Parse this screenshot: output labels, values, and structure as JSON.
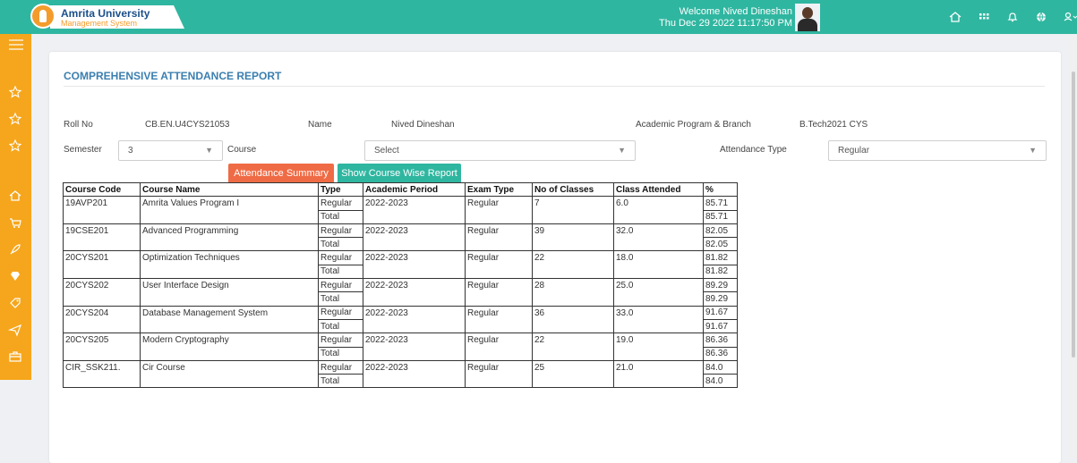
{
  "app": {
    "title": "Amrita University",
    "subtitle": "Management System"
  },
  "header": {
    "welcome": "Welcome Nived Dineshan",
    "datetime": "Thu Dec 29 2022 11:17:50 PM",
    "icons": [
      "home-icon",
      "apps-grid-icon",
      "bell-icon",
      "globe-icon",
      "user-icon"
    ]
  },
  "sidebar": {
    "items": [
      "menu-icon",
      "star-icon",
      "star-icon",
      "star-icon",
      "home-icon",
      "cart-icon",
      "rocket-icon",
      "diamond-icon",
      "tag-icon",
      "send-icon",
      "briefcase-icon"
    ]
  },
  "report": {
    "title": "COMPREHENSIVE ATTENDANCE REPORT",
    "roll_label": "Roll No",
    "roll_value": "CB.EN.U4CYS21053",
    "name_label": "Name",
    "name_value": "Nived Dineshan",
    "program_label": "Academic Program & Branch",
    "program_value": "B.Tech2021 CYS",
    "semester_label": "Semester",
    "semester_value": "3",
    "course_label": "Course",
    "course_value": "Select",
    "attendance_type_label": "Attendance Type",
    "attendance_type_value": "Regular",
    "btn_summary": "Attendance Summary",
    "btn_course_wise": "Show Course Wise Report"
  },
  "table": {
    "headers": [
      "Course Code",
      "Course Name",
      "Type",
      "Academic Period",
      "Exam Type",
      "No of Classes",
      "Class Attended",
      "%"
    ],
    "rows": [
      {
        "code": "19AVP201",
        "name": "Amrita Values Program I",
        "type": "Regular",
        "period": "2022-2023",
        "exam": "Regular",
        "classes": "7",
        "attended": "6.0",
        "pct": "85.71",
        "total_label": "Total",
        "total_pct": "85.71"
      },
      {
        "code": "19CSE201",
        "name": "Advanced Programming",
        "type": "Regular",
        "period": "2022-2023",
        "exam": "Regular",
        "classes": "39",
        "attended": "32.0",
        "pct": "82.05",
        "total_label": "Total",
        "total_pct": "82.05"
      },
      {
        "code": "20CYS201",
        "name": "Optimization Techniques",
        "type": "Regular",
        "period": "2022-2023",
        "exam": "Regular",
        "classes": "22",
        "attended": "18.0",
        "pct": "81.82",
        "total_label": "Total",
        "total_pct": "81.82"
      },
      {
        "code": "20CYS202",
        "name": "User Interface Design",
        "type": "Regular",
        "period": "2022-2023",
        "exam": "Regular",
        "classes": "28",
        "attended": "25.0",
        "pct": "89.29",
        "total_label": "Total",
        "total_pct": "89.29"
      },
      {
        "code": "20CYS204",
        "name": "Database Management System",
        "type": "Regular",
        "period": "2022-2023",
        "exam": "Regular",
        "classes": "36",
        "attended": "33.0",
        "pct": "91.67",
        "total_label": "Total",
        "total_pct": "91.67"
      },
      {
        "code": "20CYS205",
        "name": "Modern Cryptography",
        "type": "Regular",
        "period": "2022-2023",
        "exam": "Regular",
        "classes": "22",
        "attended": "19.0",
        "pct": "86.36",
        "total_label": "Total",
        "total_pct": "86.36"
      },
      {
        "code": "CIR_SSK211.",
        "name": "Cir Course",
        "type": "Regular",
        "period": "2022-2023",
        "exam": "Regular",
        "classes": "25",
        "attended": "21.0",
        "pct": "84.0",
        "total_label": "Total",
        "total_pct": "84.0"
      }
    ]
  },
  "colors": {
    "topbar": "#2fb6a0",
    "sidebar": "#f6a61c",
    "title": "#3b7fb0",
    "btn_orange": "#ef6b45",
    "btn_teal": "#2fb6a0"
  }
}
